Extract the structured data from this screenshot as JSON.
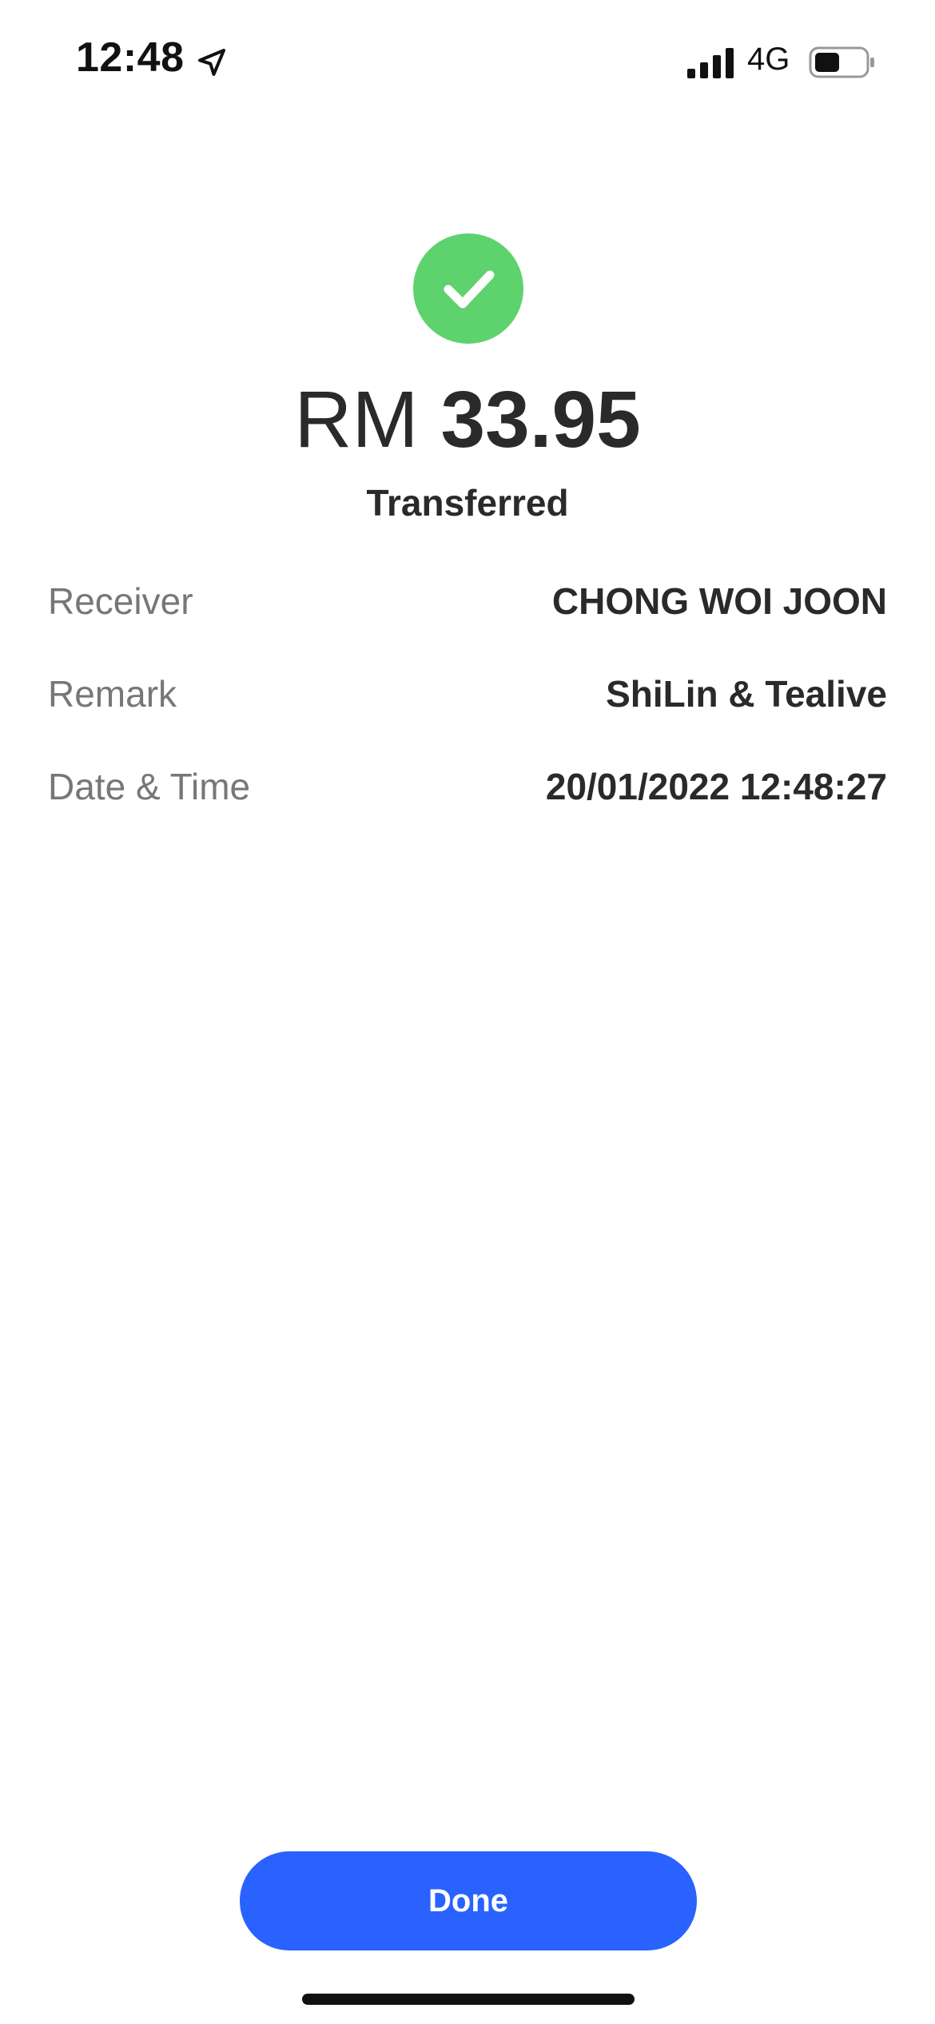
{
  "status_bar": {
    "time": "12:48",
    "network": "4G",
    "icons": [
      "location-arrow-icon",
      "cellular-signal-icon",
      "battery-icon"
    ]
  },
  "receipt": {
    "icon": "check-circle-icon",
    "accent_color": "#5ed26c",
    "currency": "RM",
    "amount": "33.95",
    "status": "Transferred",
    "details": [
      {
        "label": "Receiver",
        "value": "CHONG WOI JOON"
      },
      {
        "label": "Remark",
        "value": "ShiLin & Tealive"
      },
      {
        "label": "Date & Time",
        "value": "20/01/2022 12:48:27"
      }
    ]
  },
  "actions": {
    "done_label": "Done",
    "button_color": "#2962ff"
  }
}
